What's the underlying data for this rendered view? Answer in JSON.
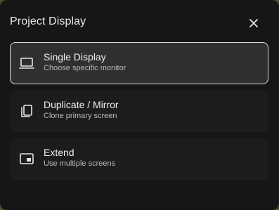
{
  "dialog": {
    "title": "Project Display",
    "close_icon": "close-icon"
  },
  "options": [
    {
      "label": "Single Display",
      "description": "Choose specific monitor",
      "icon": "laptop-icon",
      "selected": true
    },
    {
      "label": "Duplicate / Mirror",
      "description": "Clone primary screen",
      "icon": "copy-icon",
      "selected": false
    },
    {
      "label": "Extend",
      "description": "Use multiple screens",
      "icon": "extend-screen-icon",
      "selected": false
    }
  ],
  "colors": {
    "panel_background": "#161616",
    "selected_background": "#2f2f2f",
    "selected_border": "#dcdcdc",
    "option_background": "#1c1c1c",
    "text_primary": "#efefef",
    "text_secondary": "#b9b9b9"
  }
}
